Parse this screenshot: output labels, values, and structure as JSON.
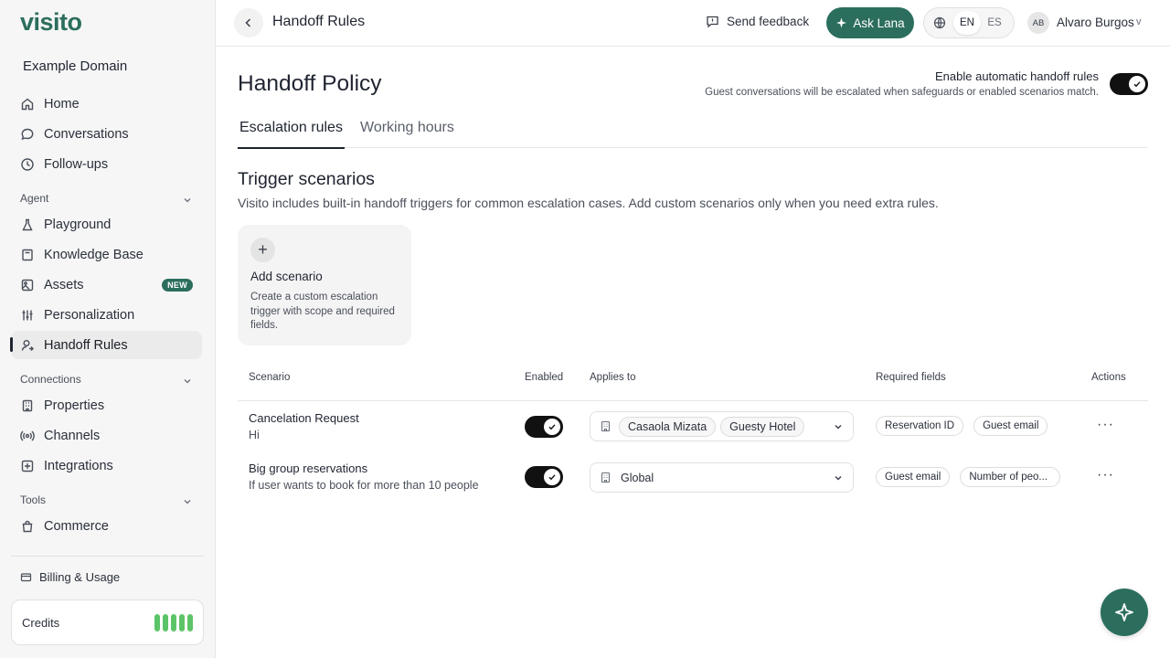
{
  "brand": {
    "logo": "visito",
    "accent": "#2c6e5e"
  },
  "sidebar": {
    "domain": "Example Domain",
    "main_items": [
      {
        "label": "Home",
        "icon": "home-icon"
      },
      {
        "label": "Conversations",
        "icon": "chat-bubble-icon"
      },
      {
        "label": "Follow-ups",
        "icon": "clock-icon"
      }
    ],
    "sections": [
      {
        "label": "Agent",
        "items": [
          {
            "label": "Playground",
            "icon": "flask-icon"
          },
          {
            "label": "Knowledge Base",
            "icon": "book-icon"
          },
          {
            "label": "Assets",
            "icon": "image-icon",
            "badge": "NEW"
          },
          {
            "label": "Personalization",
            "icon": "sliders-icon"
          },
          {
            "label": "Handoff Rules",
            "icon": "user-handoff-icon",
            "active": true
          }
        ]
      },
      {
        "label": "Connections",
        "items": [
          {
            "label": "Properties",
            "icon": "building-icon"
          },
          {
            "label": "Channels",
            "icon": "broadcast-icon"
          },
          {
            "label": "Integrations",
            "icon": "integrations-icon"
          }
        ]
      },
      {
        "label": "Tools",
        "items": [
          {
            "label": "Commerce",
            "icon": "shopping-bag-icon"
          }
        ]
      }
    ],
    "billing": "Billing & Usage",
    "credits": "Credits"
  },
  "topbar": {
    "title": "Handoff Rules",
    "feedback": "Send feedback",
    "ask": "Ask Lana",
    "languages": [
      "EN",
      "ES"
    ],
    "selected_language": "EN",
    "user_initials": "AB",
    "user_name": "Alvaro Burgos",
    "user_chevron": "v"
  },
  "main": {
    "title": "Handoff Policy",
    "auto_title": "Enable automatic handoff rules",
    "auto_sub": "Guest conversations will be escalated when safeguards or enabled scenarios match.",
    "auto_enabled": true,
    "tabs": [
      "Escalation rules",
      "Working hours"
    ],
    "selected_tab": "Escalation rules",
    "section_title": "Trigger scenarios",
    "section_desc": "Visito includes built-in handoff triggers for common escalation cases. Add custom scenarios only when you need extra rules.",
    "add_card": {
      "plus": "+",
      "title": "Add scenario",
      "desc": "Create a custom escalation trigger with scope and required fields."
    },
    "table": {
      "headers": [
        "Scenario",
        "Enabled",
        "Applies to",
        "Required fields",
        "Actions"
      ],
      "rows": [
        {
          "title": "Cancelation Request",
          "desc": "Hi",
          "enabled": true,
          "applies": [
            "Casaola Mizata",
            "Guesty Hotel"
          ],
          "required": [
            "Reservation ID",
            "Guest email"
          ],
          "actions": "···"
        },
        {
          "title": "Big group reservations",
          "desc": "If user wants to book for more than 10 people",
          "enabled": true,
          "applies_plain": "Global",
          "required": [
            "Guest email",
            "Number of peo..."
          ],
          "actions": "···"
        }
      ]
    }
  }
}
